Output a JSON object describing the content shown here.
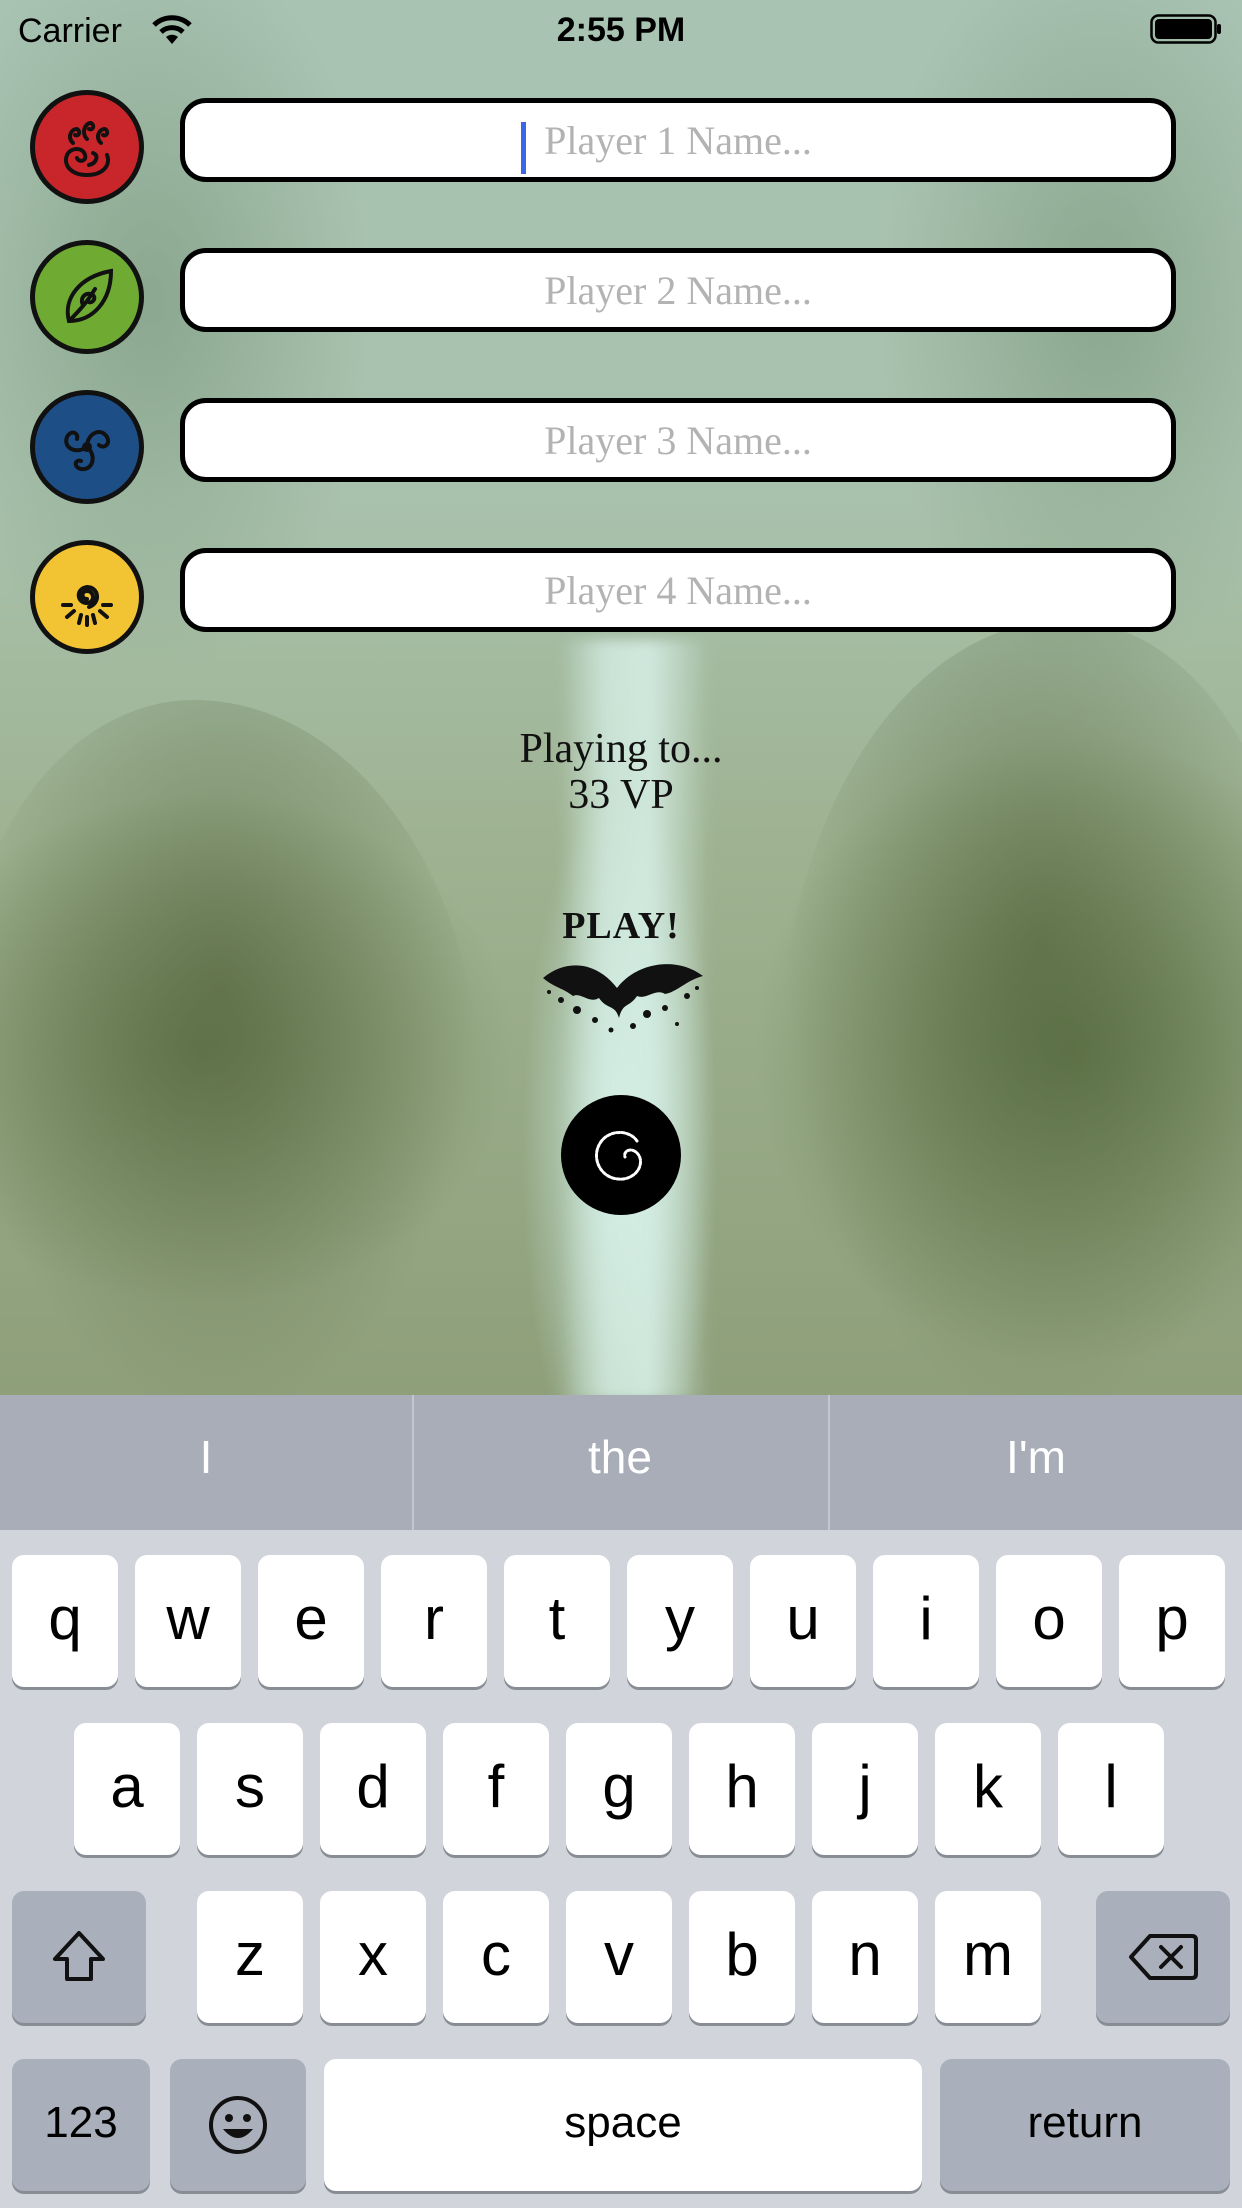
{
  "status_bar": {
    "carrier": "Carrier",
    "time": "2:55 PM"
  },
  "players": [
    {
      "placeholder": "Player 1 Name...",
      "emblem": "fire-emblem-icon",
      "color": "#c8262a"
    },
    {
      "placeholder": "Player 2 Name...",
      "emblem": "leaf-emblem-icon",
      "color": "#6fab33"
    },
    {
      "placeholder": "Player 3 Name...",
      "emblem": "triskelion-water-emblem-icon",
      "color": "#1d4f86"
    },
    {
      "placeholder": "Player 4 Name...",
      "emblem": "sun-emblem-icon",
      "color": "#f2c434"
    }
  ],
  "victory": {
    "label": "Playing to...",
    "value": "33 VP"
  },
  "play_button": {
    "label": "PLAY!",
    "icon": "ink-splatter-icon"
  },
  "spiral_button": {
    "icon": "spiral-icon"
  },
  "keyboard": {
    "suggestions": [
      "I",
      "the",
      "I'm"
    ],
    "row1": [
      "q",
      "w",
      "e",
      "r",
      "t",
      "y",
      "u",
      "i",
      "o",
      "p"
    ],
    "row2": [
      "a",
      "s",
      "d",
      "f",
      "g",
      "h",
      "j",
      "k",
      "l"
    ],
    "row3": [
      "z",
      "x",
      "c",
      "v",
      "b",
      "n",
      "m"
    ],
    "numbers_label": "123",
    "space_label": "space",
    "return_label": "return"
  }
}
